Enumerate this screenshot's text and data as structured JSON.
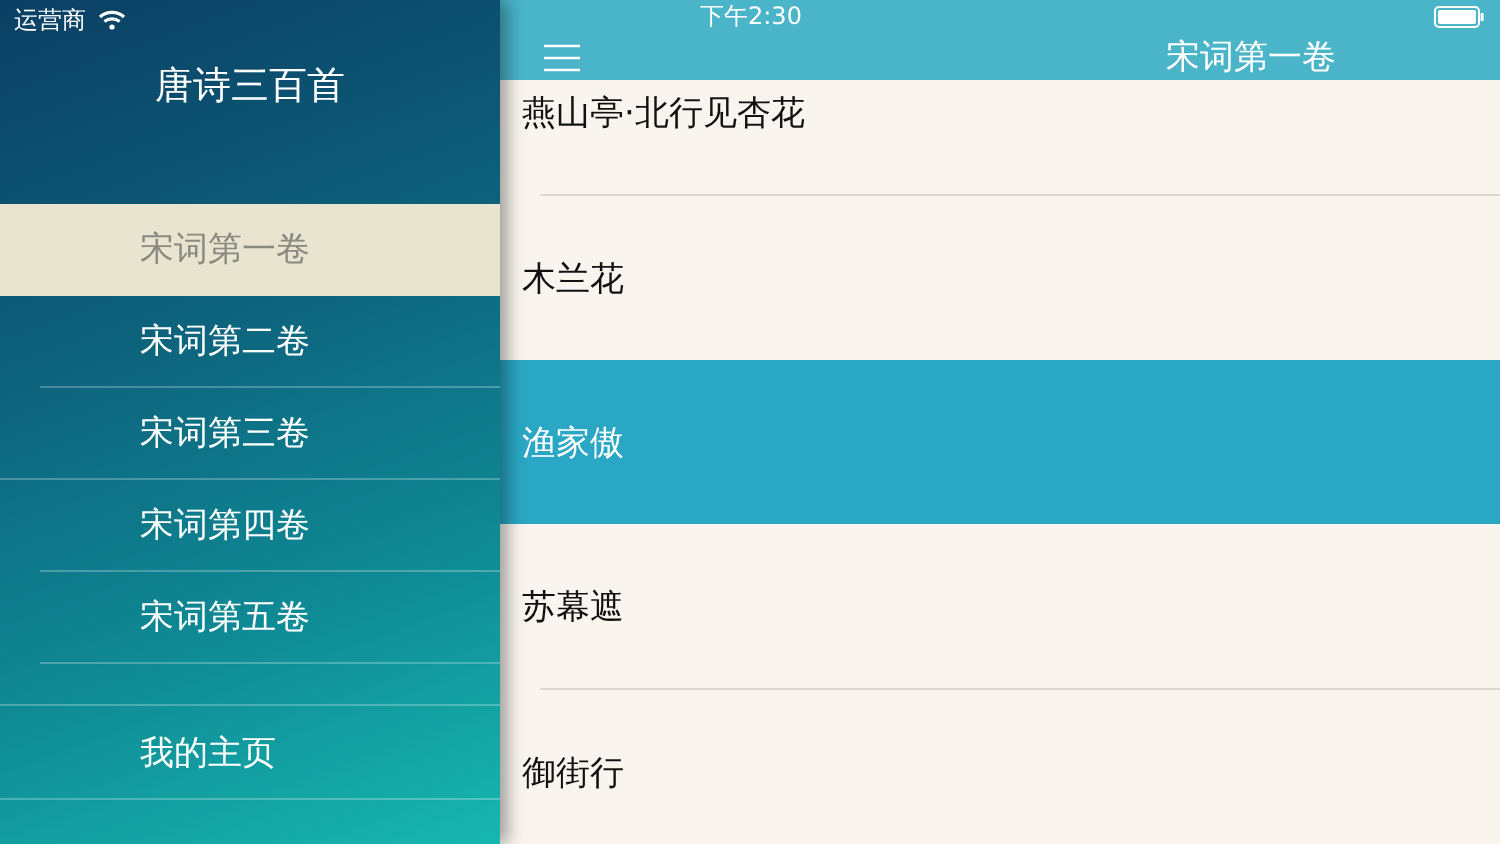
{
  "status_bar": {
    "carrier": "运营商",
    "time": "下午2:30"
  },
  "sidebar": {
    "title": "唐诗三百首",
    "volumes": [
      {
        "label": "宋词第一卷",
        "selected": true
      },
      {
        "label": "宋词第二卷",
        "selected": false
      },
      {
        "label": "宋词第三卷",
        "selected": false
      },
      {
        "label": "宋词第四卷",
        "selected": false
      },
      {
        "label": "宋词第五卷",
        "selected": false
      }
    ],
    "home_link": "我的主页"
  },
  "nav_bar": {
    "title": "宋词第一卷"
  },
  "poems": [
    {
      "title": "燕山亭·北行见杏花",
      "selected": false
    },
    {
      "title": "木兰花",
      "selected": false
    },
    {
      "title": "渔家傲",
      "selected": true
    },
    {
      "title": "苏幕遮",
      "selected": false
    },
    {
      "title": "御街行",
      "selected": false
    }
  ]
}
